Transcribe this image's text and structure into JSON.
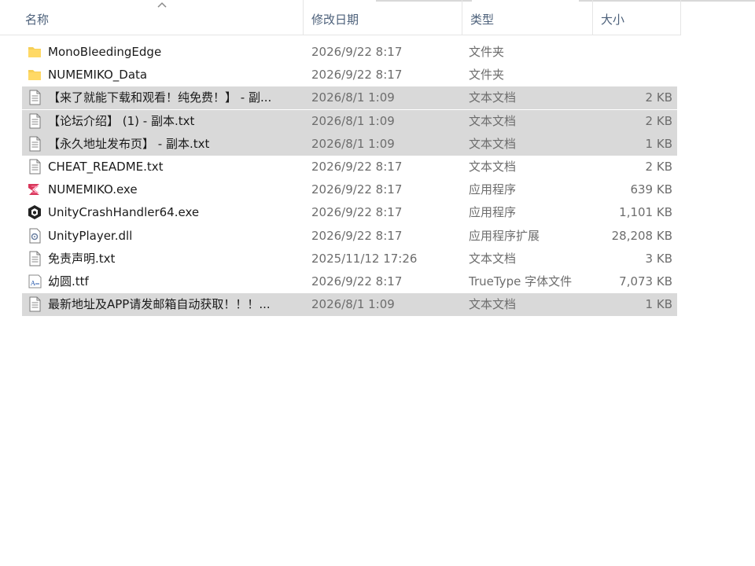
{
  "columns": {
    "name": "名称",
    "date": "修改日期",
    "type": "类型",
    "size": "大小"
  },
  "files": [
    {
      "name": "MonoBleedingEdge",
      "date": "2026/9/22 8:17",
      "type": "文件夹",
      "size": "",
      "icon": "folder-icon",
      "selected": false
    },
    {
      "name": "NUMEMIKO_Data",
      "date": "2026/9/22 8:17",
      "type": "文件夹",
      "size": "",
      "icon": "folder-icon",
      "selected": false
    },
    {
      "name": "【来了就能下载和观看！纯免费！】 - 副...",
      "date": "2026/8/1 1:09",
      "type": "文本文档",
      "size": "2 KB",
      "icon": "text-file-icon",
      "selected": true
    },
    {
      "name": "【论坛介绍】 (1) - 副本.txt",
      "date": "2026/8/1 1:09",
      "type": "文本文档",
      "size": "2 KB",
      "icon": "text-file-icon",
      "selected": true
    },
    {
      "name": "【永久地址发布页】 - 副本.txt",
      "date": "2026/8/1 1:09",
      "type": "文本文档",
      "size": "1 KB",
      "icon": "text-file-icon",
      "selected": true
    },
    {
      "name": "CHEAT_README.txt",
      "date": "2026/9/22 8:17",
      "type": "文本文档",
      "size": "2 KB",
      "icon": "text-file-icon",
      "selected": false
    },
    {
      "name": "NUMEMIKO.exe",
      "date": "2026/9/22 8:17",
      "type": "应用程序",
      "size": "639 KB",
      "icon": "app-exe-icon",
      "selected": false
    },
    {
      "name": "UnityCrashHandler64.exe",
      "date": "2026/9/22 8:17",
      "type": "应用程序",
      "size": "1,101 KB",
      "icon": "unity-icon",
      "selected": false
    },
    {
      "name": "UnityPlayer.dll",
      "date": "2026/9/22 8:17",
      "type": "应用程序扩展",
      "size": "28,208 KB",
      "icon": "dll-gear-icon",
      "selected": false
    },
    {
      "name": "免责声明.txt",
      "date": "2025/11/12 17:26",
      "type": "文本文档",
      "size": "3 KB",
      "icon": "text-file-icon",
      "selected": false
    },
    {
      "name": "幼圆.ttf",
      "date": "2026/9/22 8:17",
      "type": "TrueType 字体文件",
      "size": "7,073 KB",
      "icon": "font-file-icon",
      "selected": false
    },
    {
      "name": "最新地址及APP请发邮箱自动获取！！！...",
      "date": "2026/8/1 1:09",
      "type": "文本文档",
      "size": "1 KB",
      "icon": "text-file-icon",
      "selected": true
    }
  ]
}
